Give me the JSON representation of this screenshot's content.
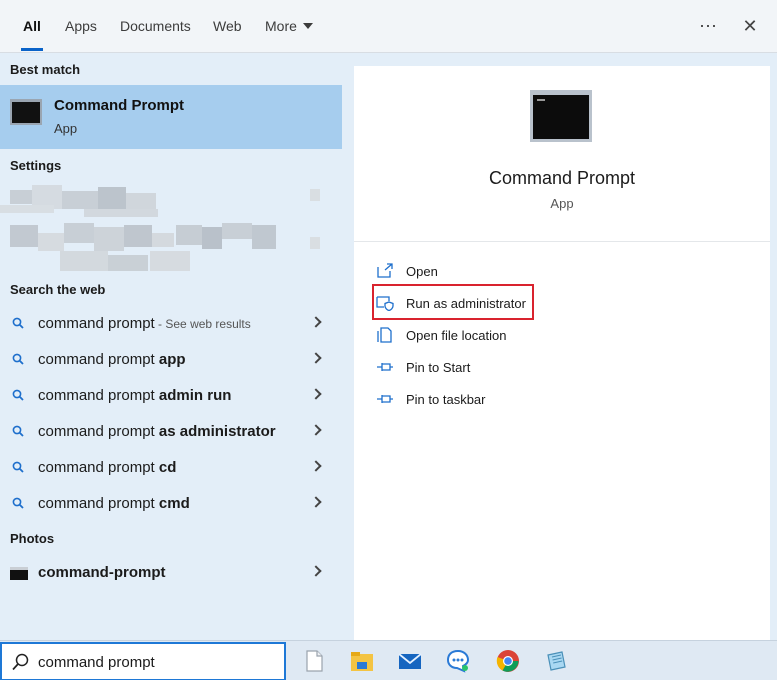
{
  "tabs": [
    {
      "label": "All",
      "active": true
    },
    {
      "label": "Apps"
    },
    {
      "label": "Documents"
    },
    {
      "label": "Web"
    },
    {
      "label": "More"
    }
  ],
  "top_icons": {
    "more_options": "⋯",
    "close": "✕"
  },
  "sections": {
    "best_match": "Best match",
    "settings": "Settings",
    "search_web": "Search the web",
    "photos": "Photos"
  },
  "best_match": {
    "title": "Command Prompt",
    "subtitle": "App"
  },
  "web_results": [
    {
      "plain": "command prompt",
      "bold": "",
      "hint": " - See web results"
    },
    {
      "plain": "command prompt ",
      "bold": "app",
      "hint": ""
    },
    {
      "plain": "command prompt ",
      "bold": "admin run",
      "hint": ""
    },
    {
      "plain": "command prompt ",
      "bold": "as administrator",
      "hint": ""
    },
    {
      "plain": "command prompt ",
      "bold": "cd",
      "hint": ""
    },
    {
      "plain": "command prompt ",
      "bold": "cmd",
      "hint": ""
    }
  ],
  "photo_result": {
    "label": "command-prompt"
  },
  "preview": {
    "title": "Command Prompt",
    "subtitle": "App",
    "actions": [
      {
        "label": "Open",
        "icon": "open-icon"
      },
      {
        "label": "Run as administrator",
        "icon": "shield-icon"
      },
      {
        "label": "Open file location",
        "icon": "file-location-icon"
      },
      {
        "label": "Pin to Start",
        "icon": "pin-icon"
      },
      {
        "label": "Pin to taskbar",
        "icon": "pin-icon"
      }
    ]
  },
  "taskbar": {
    "search_value": "command prompt",
    "apps": [
      "file-icon",
      "file-explorer-icon",
      "mail-icon",
      "chat-icon",
      "chrome-icon",
      "notepad-icon"
    ]
  },
  "colors": {
    "accent": "#0a63c9",
    "selection": "#a6cdee",
    "highlight_border": "#d9232e"
  }
}
